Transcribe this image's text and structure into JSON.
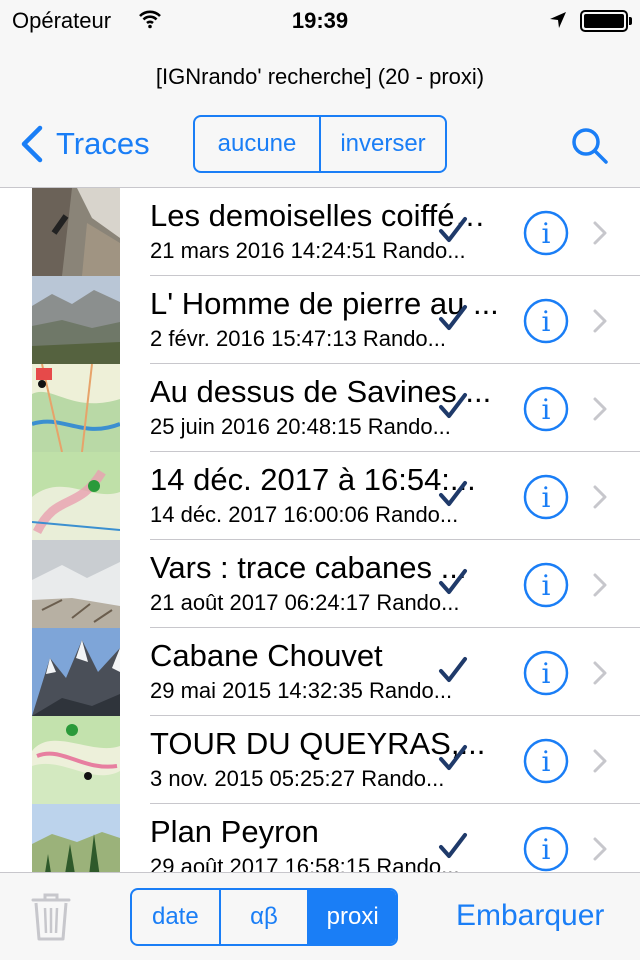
{
  "status_bar": {
    "carrier": "Opérateur",
    "time": "19:39",
    "battery_level": 1.0,
    "icons": [
      "wifi-icon",
      "location-arrow-icon",
      "battery-icon"
    ]
  },
  "nav": {
    "subtitle": "[IGNrando' recherche] (20 - proxi)",
    "back_label": "Traces",
    "segments": [
      "aucune",
      "inverser"
    ],
    "search_icon": "search-icon"
  },
  "rows": [
    {
      "title": "Les demoiselles coiffées de ...",
      "subtitle": "21 mars 2016 14:24:51 Rando...",
      "checked": true,
      "thumb": "rock"
    },
    {
      "title": "L' Homme de pierre au ...",
      "subtitle": "2 févr. 2016 15:47:13 Rando...",
      "checked": true,
      "thumb": "valley"
    },
    {
      "title": "Au dessus de Savines ...",
      "subtitle": "25 juin 2016 20:48:15 Rando...",
      "checked": true,
      "thumb": "map"
    },
    {
      "title": "14 déc. 2017 à 16:54:...",
      "subtitle": "14 déc. 2017 16:00:06 Rando...",
      "checked": true,
      "thumb": "map2"
    },
    {
      "title": "Vars : trace cabanes ...",
      "subtitle": "21 août 2017 06:24:17 Rando...",
      "checked": true,
      "thumb": "snow"
    },
    {
      "title": "Cabane Chouvet",
      "subtitle": "29 mai 2015 14:32:35 Rando...",
      "checked": true,
      "thumb": "peaks"
    },
    {
      "title": "TOUR DU QUEYRAS,...",
      "subtitle": "3 nov. 2015 05:25:27 Rando...",
      "checked": true,
      "thumb": "map3"
    },
    {
      "title": "Plan Peyron",
      "subtitle": "29 août 2017 16:58:15 Rando...",
      "checked": true,
      "thumb": "forest"
    }
  ],
  "toolbar": {
    "sort_segments": [
      "date",
      "αβ",
      "proxi"
    ],
    "active_sort": "proxi",
    "embark_label": "Embarquer",
    "trash_icon": "trash-icon"
  },
  "colors": {
    "accent": "#1a7ef6",
    "check": "#1f3a6a",
    "bar_background": "#f7f7f7",
    "separator": "#c8c7cc"
  }
}
